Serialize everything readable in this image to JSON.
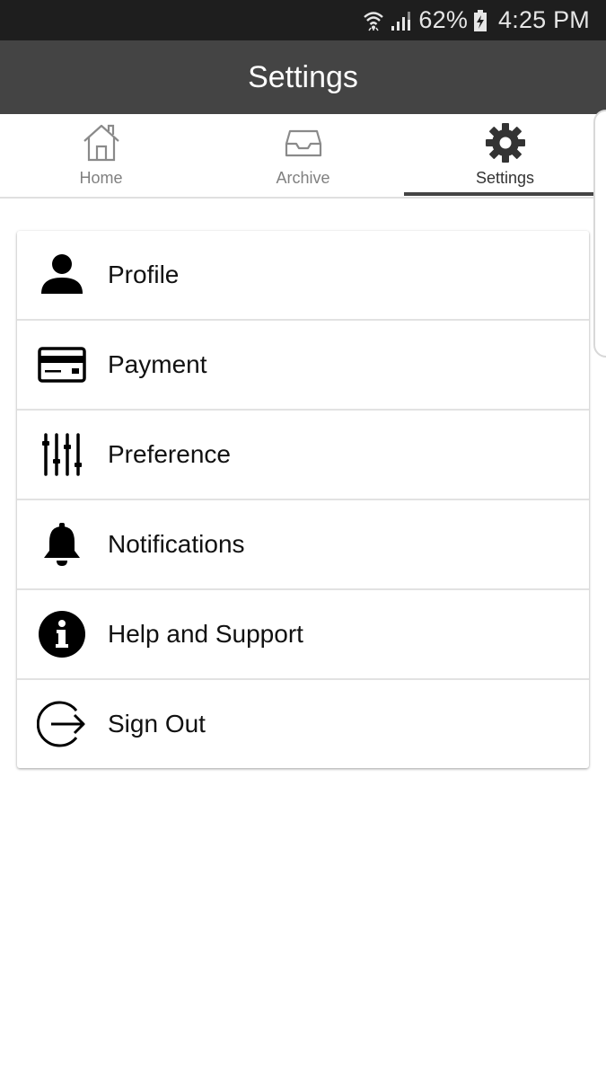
{
  "status_bar": {
    "battery": "62%",
    "time": "4:25 PM",
    "icons": [
      "wifi-icon",
      "signal-icon",
      "battery-charging-icon"
    ]
  },
  "app_bar": {
    "title": "Settings"
  },
  "tabs": [
    {
      "label": "Home",
      "icon": "home-icon",
      "active": false
    },
    {
      "label": "Archive",
      "icon": "inbox-tray-icon",
      "active": false
    },
    {
      "label": "Settings",
      "icon": "gear-icon",
      "active": true
    }
  ],
  "menu": {
    "items": [
      {
        "label": "Profile",
        "icon": "person-icon"
      },
      {
        "label": "Payment",
        "icon": "credit-card-icon"
      },
      {
        "label": "Preference",
        "icon": "sliders-icon"
      },
      {
        "label": "Notifications",
        "icon": "bell-icon"
      },
      {
        "label": "Help and Support",
        "icon": "info-icon"
      },
      {
        "label": "Sign Out",
        "icon": "sign-out-icon"
      }
    ]
  },
  "colors": {
    "status_bar_bg": "#1e1e1e",
    "app_bar_bg": "#444444",
    "tab_indicator": "#444444",
    "inactive_tab_text": "#808080",
    "active_tab_text": "#333333"
  }
}
